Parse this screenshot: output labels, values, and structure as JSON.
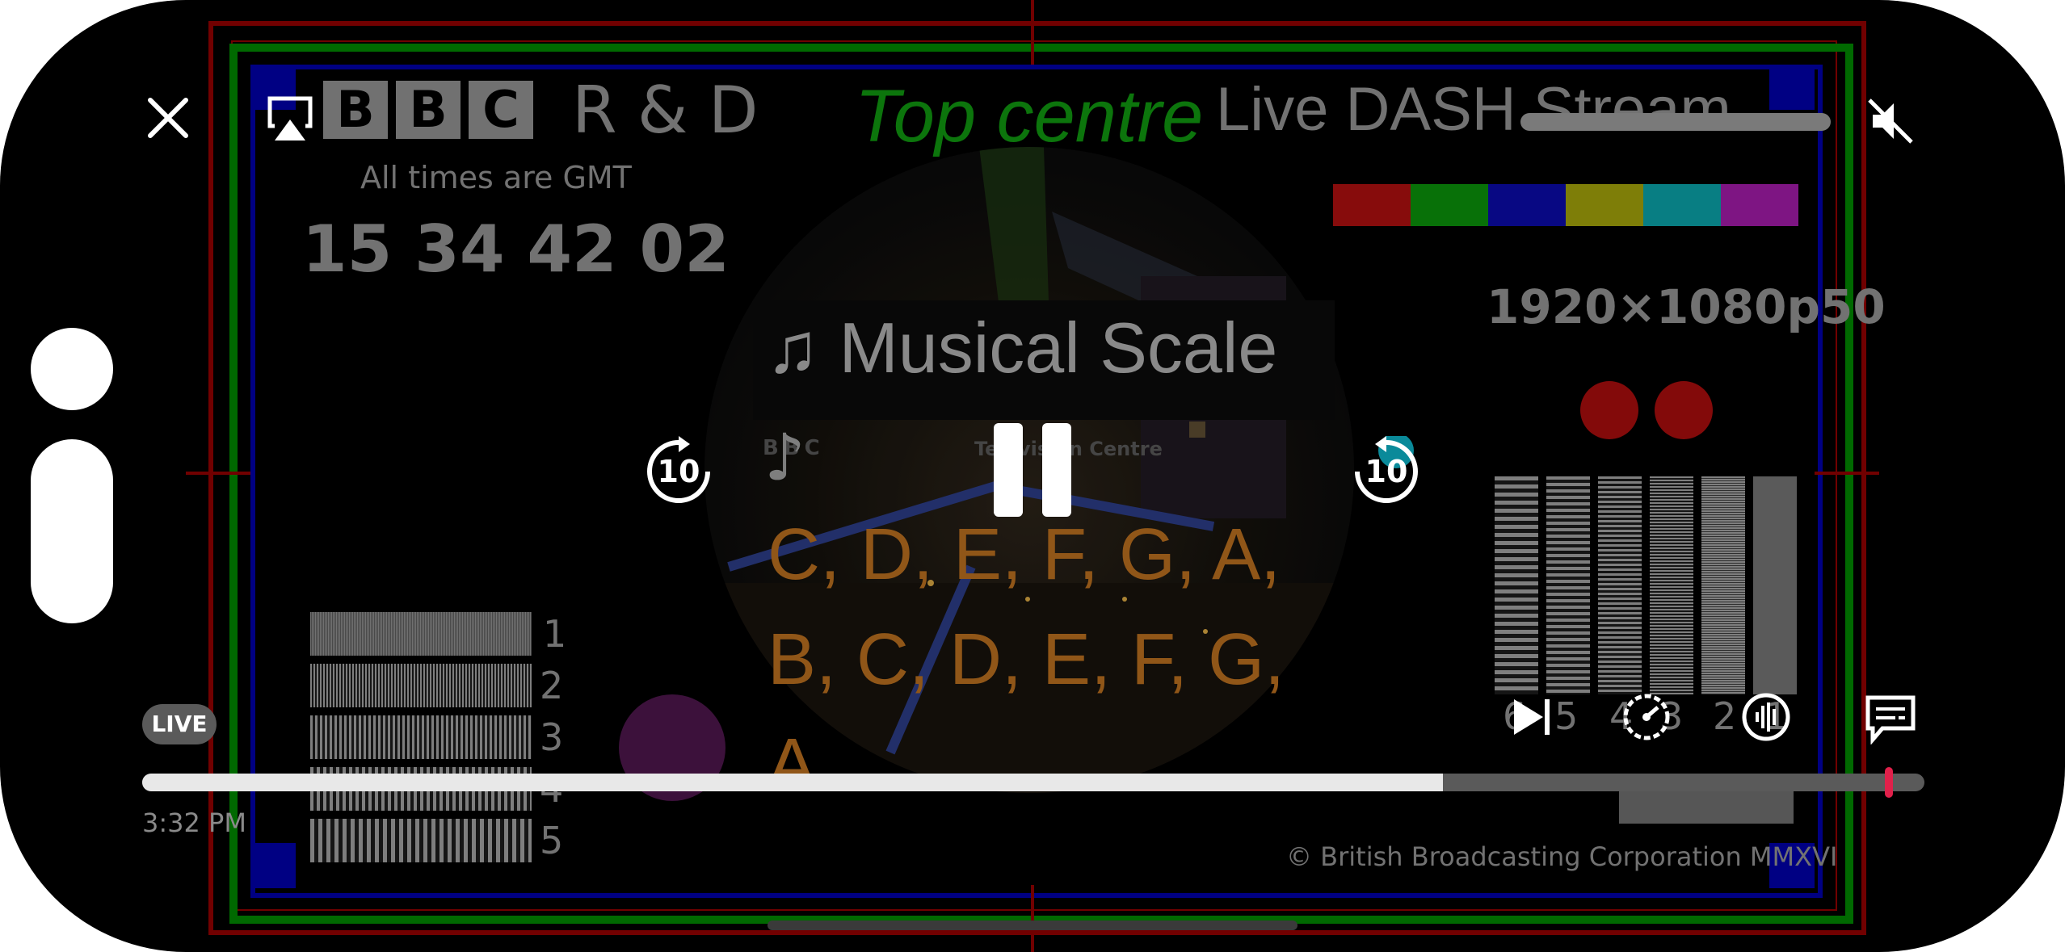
{
  "channel_logo": {
    "letters": [
      "B",
      "B",
      "C"
    ],
    "suffix": "R & D"
  },
  "timezone_note": "All times are GMT",
  "timecode": "15 34 42 02",
  "top_centre_label": "Top centre",
  "stream_title": "Live DASH Stream",
  "resolution": "1920×1080p50",
  "caption_title": "♫ Musical Scale",
  "scale_lines": [
    "C, D, E, F, G, A,",
    "B, C, D, E, F, G,",
    "A"
  ],
  "inner_card": {
    "logo": "BBC",
    "label": "Television Centre"
  },
  "left_sweep_labels": [
    "1",
    "2",
    "3",
    "4",
    "5"
  ],
  "right_sweep_labels": [
    "6",
    "5",
    "4",
    "3",
    "2",
    "1"
  ],
  "copyright": "© British Broadcasting Corporation MMXVI",
  "live_badge": "LIVE",
  "clock": "3:32 PM",
  "player": {
    "progress_fraction": 0.73,
    "playhead_fraction": 0.98,
    "skip_back_seconds": "10",
    "skip_forward_seconds": "10"
  },
  "colour_bars": [
    "#a50f0f",
    "#0a8a0a",
    "#0a0aa0",
    "#9a9a0a",
    "#0a9aa0",
    "#9a1aa0"
  ],
  "frame_colors": {
    "red": "#a80000",
    "green": "#009000",
    "blue": "#0000b0"
  },
  "icons": {
    "close": "close-icon",
    "airplay": "airplay-icon",
    "mute": "speaker-muted-icon",
    "pause": "pause-icon",
    "back": "skip-back-10-icon",
    "forward": "skip-forward-10-icon",
    "next": "next-episode-icon",
    "speed": "playback-speed-icon",
    "audio": "audio-track-icon",
    "subtitles": "subtitles-icon"
  }
}
